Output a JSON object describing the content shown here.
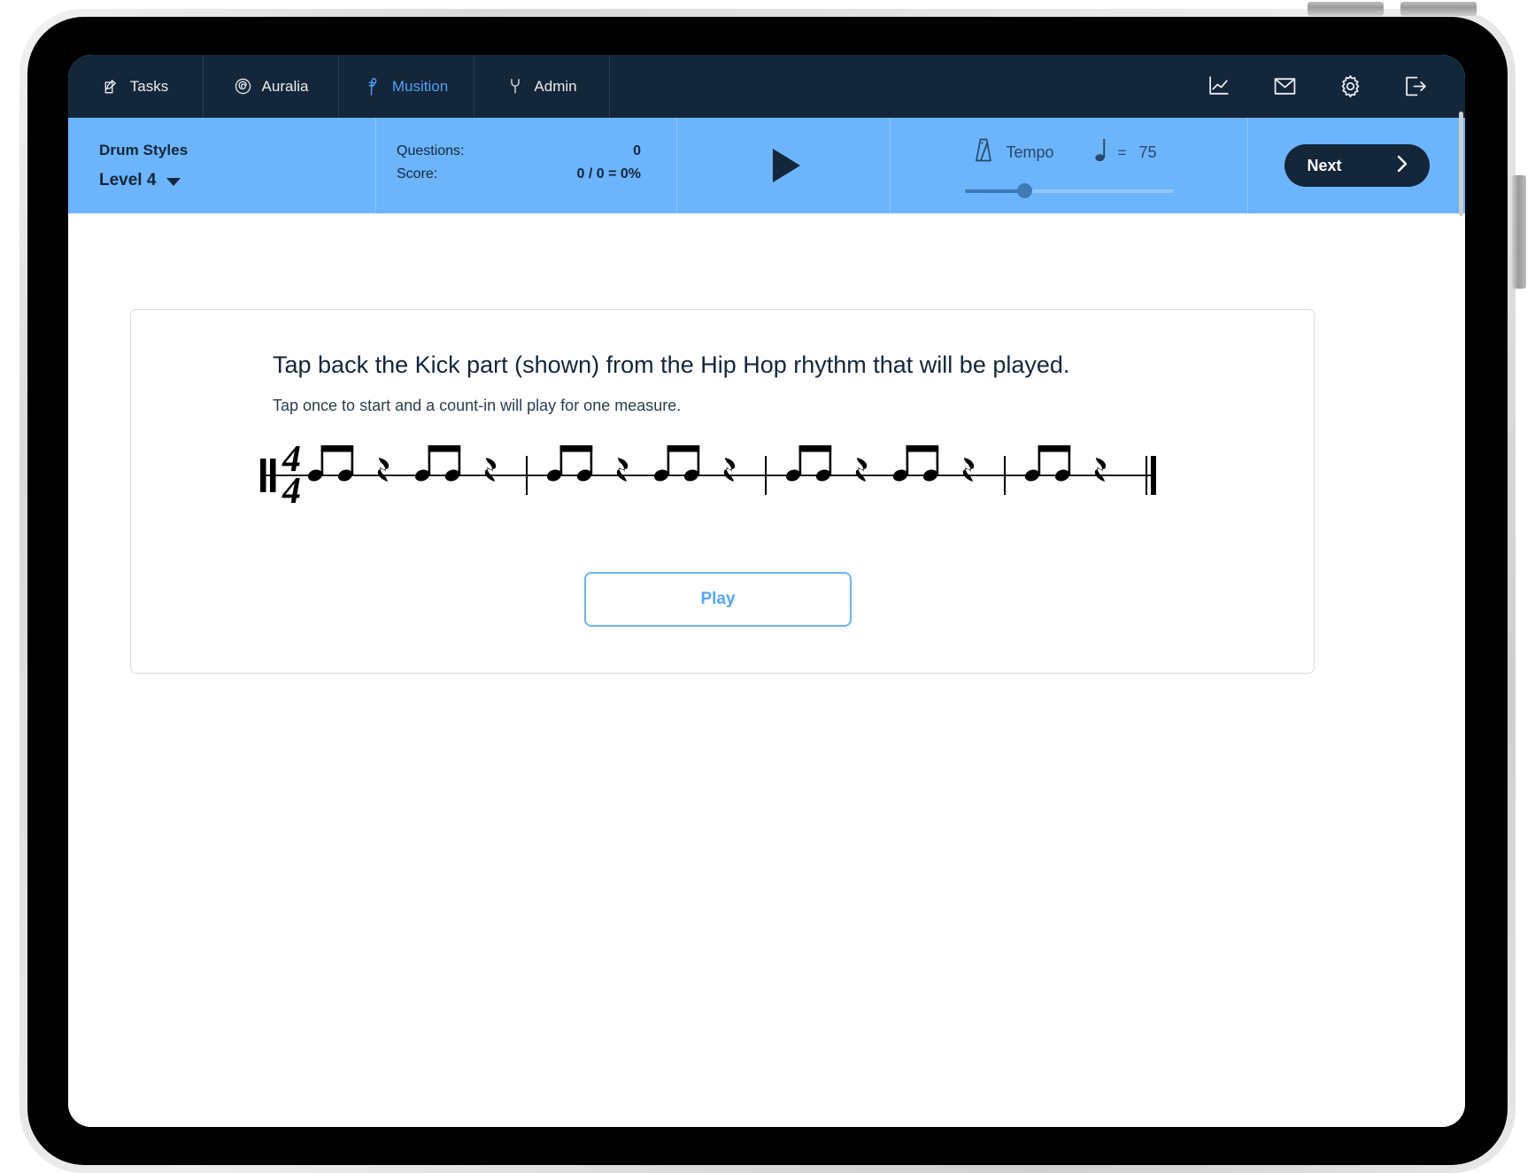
{
  "app": {
    "accent_blue": "#6cb4fb",
    "dark_navy": "#13263a",
    "link_blue": "#55a6f6"
  },
  "topnav": {
    "tabs": [
      {
        "label": "Tasks",
        "icon": "pencil-square-icon",
        "active": false
      },
      {
        "label": "Auralia",
        "icon": "spiral-icon",
        "active": false
      },
      {
        "label": "Musition",
        "icon": "treble-flourish-icon",
        "active": true
      },
      {
        "label": "Admin",
        "icon": "wrench-icon",
        "active": false
      }
    ],
    "icons": [
      {
        "name": "chart-icon",
        "title": "Reports"
      },
      {
        "name": "mail-icon",
        "title": "Messages"
      },
      {
        "name": "gear-icon",
        "title": "Settings"
      },
      {
        "name": "logout-icon",
        "title": "Sign out"
      }
    ]
  },
  "toolbar": {
    "course_title": "Drum Styles",
    "level_label": "Level 4",
    "stats": {
      "questions_label": "Questions:",
      "questions_value": "0",
      "score_label": "Score:",
      "score_value": "0 / 0 = 0%"
    },
    "play_icon": "play-triangle-icon",
    "tempo": {
      "metronome_icon": "metronome-icon",
      "label": "Tempo",
      "note_icon": "quarter-note-icon",
      "equals": "=",
      "bpm": "75",
      "slider_percent": 28.5
    },
    "next_label": "Next",
    "next_icon": "chevron-right-icon"
  },
  "question": {
    "title": "Tap back the Kick part (shown) from the Hip Hop rhythm that will be played.",
    "subtitle": "Tap once to start and a count-in will play for one measure.",
    "play_button_label": "Play"
  },
  "notation": {
    "clef": "percussion-clef",
    "time_signature_top": "4",
    "time_signature_bottom": "4",
    "measures": 4,
    "final_barline": "light-heavy",
    "pattern_per_half_measure": [
      "eighth-note",
      "eighth-note",
      "eighth-rest"
    ],
    "groups": [
      {
        "measure": 1,
        "beat": 1,
        "notes": [
          "eighth-note",
          "eighth-note"
        ],
        "rest": "eighth-rest"
      },
      {
        "measure": 1,
        "beat": 3,
        "notes": [
          "eighth-note",
          "eighth-note"
        ],
        "rest": "eighth-rest"
      },
      {
        "measure": 2,
        "beat": 1,
        "notes": [
          "eighth-note",
          "eighth-note"
        ],
        "rest": "eighth-rest"
      },
      {
        "measure": 2,
        "beat": 3,
        "notes": [
          "eighth-note",
          "eighth-note"
        ],
        "rest": "eighth-rest"
      },
      {
        "measure": 3,
        "beat": 1,
        "notes": [
          "eighth-note",
          "eighth-note"
        ],
        "rest": "eighth-rest"
      },
      {
        "measure": 3,
        "beat": 3,
        "notes": [
          "eighth-note",
          "eighth-note"
        ],
        "rest": "eighth-rest"
      },
      {
        "measure": 4,
        "beat": 1,
        "notes": [
          "eighth-note",
          "eighth-note"
        ],
        "rest": "eighth-rest"
      },
      {
        "measure": 4,
        "beat": 3,
        "notes": [
          "eighth-note",
          "eighth-note"
        ],
        "rest": "eighth-rest"
      }
    ]
  }
}
